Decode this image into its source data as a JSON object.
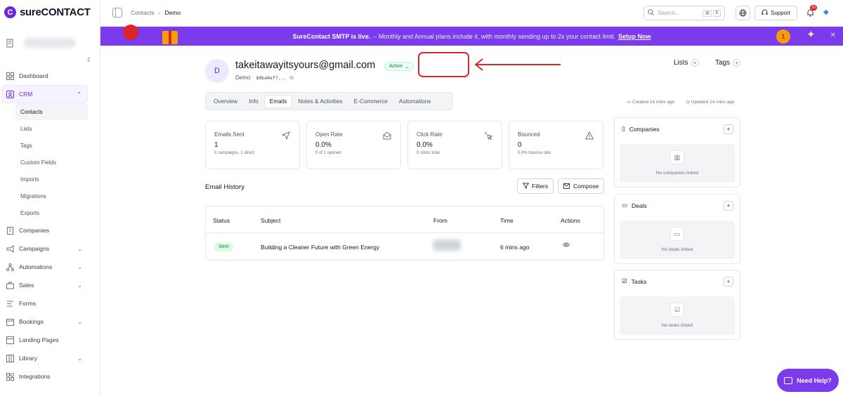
{
  "app": {
    "logo_letter": "C",
    "logo_text": "sureCONTACT"
  },
  "sidebar": {
    "items": [
      {
        "label": "Dashboard",
        "icon": "dashboard-icon"
      },
      {
        "label": "CRM",
        "icon": "crm-icon",
        "active": true
      },
      {
        "label": "Companies",
        "icon": "building-icon"
      },
      {
        "label": "Campaigns",
        "icon": "megaphone-icon"
      },
      {
        "label": "Automations",
        "icon": "workflow-icon"
      },
      {
        "label": "Sales",
        "icon": "briefcase-icon"
      },
      {
        "label": "Forms",
        "icon": "form-icon"
      },
      {
        "label": "Bookings",
        "icon": "calendar-icon"
      },
      {
        "label": "Landing Pages",
        "icon": "page-icon"
      },
      {
        "label": "Library",
        "icon": "library-icon"
      },
      {
        "label": "Integrations",
        "icon": "integrations-icon"
      }
    ],
    "crm_sub": [
      "Contacts",
      "Lists",
      "Tags",
      "Custom Fields",
      "Imports",
      "Migrations",
      "Exports"
    ]
  },
  "topbar": {
    "breadcrumb": [
      "Contacts",
      "Demo"
    ],
    "search_placeholder": "Search...",
    "shortcut": [
      "⌘",
      "K"
    ],
    "support_label": "Support",
    "notification_count": "10"
  },
  "banner": {
    "title": "SureContact SMTP is live.",
    "text": "– Monthly and Annual plans include it, with monthly sending up to 2x your contact limit.",
    "link": "Setup Now",
    "medal": "1"
  },
  "contact": {
    "initial": "D",
    "email": "takeitawayitsyours@gmail.com",
    "status": "Active",
    "name": "Demo",
    "id": "$0ba9ef7..."
  },
  "header_actions": {
    "lists": "Lists",
    "tags": "Tags"
  },
  "tabs": [
    "Overview",
    "Info",
    "Emails",
    "Notes & Activities",
    "E-Commerce",
    "Automations"
  ],
  "active_tab": "Emails",
  "meta": {
    "created": "Created 14 mins ago",
    "updated": "Updated 14 mins ago"
  },
  "stats": [
    {
      "label": "Emails Sent",
      "value": "1",
      "sub": "0 campaigns, 1 direct",
      "icon": "send-icon"
    },
    {
      "label": "Open Rate",
      "value": "0.0%",
      "sub": "0 of 1 opened",
      "icon": "envelope-open-icon"
    },
    {
      "label": "Click Rate",
      "value": "0.0%",
      "sub": "0 clicks total",
      "icon": "click-icon"
    },
    {
      "label": "Bounced",
      "value": "0",
      "sub": "0.0% bounce rate",
      "icon": "warning-icon"
    }
  ],
  "email_history": {
    "title": "Email History",
    "filters_label": "Filters",
    "compose_label": "Compose",
    "columns": [
      "Status",
      "Subject",
      "From",
      "Time",
      "Actions"
    ],
    "rows": [
      {
        "status": "Sent",
        "subject": "Building a Cleaner Future with Green Energy",
        "time": "6 mins ago"
      }
    ]
  },
  "panels": [
    {
      "title": "Companies",
      "empty": "No companies linked"
    },
    {
      "title": "Deals",
      "empty": "No deals linked"
    },
    {
      "title": "Tasks",
      "empty": "No tasks linked"
    }
  ],
  "help": {
    "label": "Need Help?"
  },
  "colors": {
    "brand": "#7c3aed",
    "annotation": "#dc2626",
    "success": "#15803d"
  }
}
